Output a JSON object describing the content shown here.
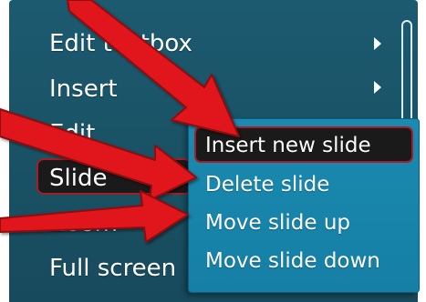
{
  "menu": {
    "items": [
      {
        "label": "Edit textbox",
        "has_submenu": true
      },
      {
        "label": "Insert",
        "has_submenu": true
      },
      {
        "label": "Edit",
        "has_submenu": false
      },
      {
        "label": "Slide",
        "has_submenu": true,
        "selected": true
      },
      {
        "label": "Zoom",
        "has_submenu": false
      },
      {
        "label": "Full screen",
        "has_submenu": false
      }
    ]
  },
  "submenu": {
    "items": [
      {
        "label": "Insert new slide",
        "selected": true
      },
      {
        "label": "Delete slide"
      },
      {
        "label": "Move slide up"
      },
      {
        "label": "Move slide down"
      }
    ]
  },
  "colors": {
    "menu_background": "#1a5366",
    "submenu_background": "#1785ab",
    "selection_background": "#1a1a1a",
    "selection_border": "#a31e2a",
    "annotation_arrow": "#e0141b"
  },
  "icons": [
    "chevron-right-icon",
    "annotation-arrow"
  ]
}
